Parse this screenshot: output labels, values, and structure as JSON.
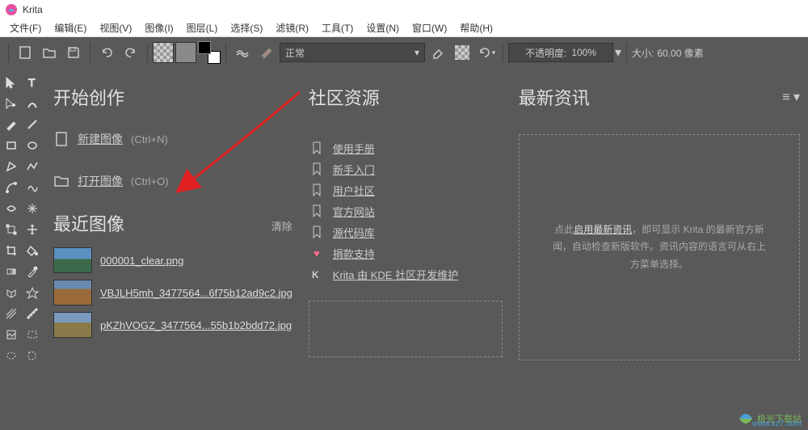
{
  "app": {
    "title": "Krita"
  },
  "menubar": [
    "文件(F)",
    "编辑(E)",
    "视图(V)",
    "图像(I)",
    "图层(L)",
    "选择(S)",
    "滤镜(R)",
    "工具(T)",
    "设置(N)",
    "窗口(W)",
    "帮助(H)"
  ],
  "toolbar": {
    "blend_mode": "正常",
    "opacity_label": "不透明度:",
    "opacity_value": "100%",
    "size_label": "大小:",
    "size_value": "60.00 像素"
  },
  "start": {
    "title": "开始创作",
    "new_image": "新建图像",
    "new_shortcut": "(Ctrl+N)",
    "open_image": "打开图像",
    "open_shortcut": "(Ctrl+O)"
  },
  "recent": {
    "title": "最近图像",
    "clear": "清除",
    "items": [
      "000001_clear.png",
      "VBJLH5mh_3477564...6f75b12ad9c2.jpg",
      "pKZhVOGZ_3477564...55b1b2bdd72.jpg"
    ]
  },
  "community": {
    "title": "社区资源",
    "links": [
      "使用手册",
      "新手入门",
      "用户社区",
      "官方网站",
      "源代码库",
      "捐款支持",
      "Krita 由 KDE 社区开发维护"
    ]
  },
  "news": {
    "title": "最新资讯",
    "prefix": "点此",
    "link": "启用最新资讯",
    "suffix1": "，即可显示 Krita 的最新官方新",
    "suffix2": "闻，自动检查新版软件。资讯内容的语言可从右上",
    "suffix3": "方菜单选择。"
  },
  "watermark": {
    "text": "极光下载站",
    "url": "www.xz7.com"
  }
}
